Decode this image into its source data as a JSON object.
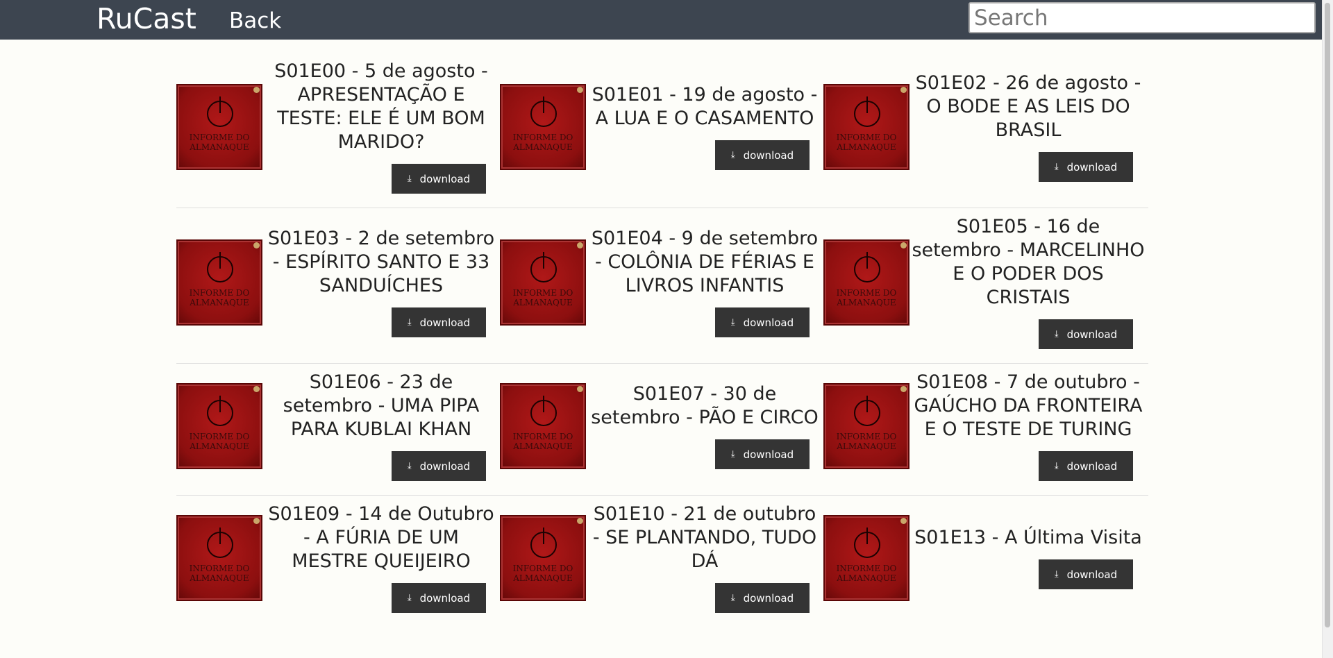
{
  "nav": {
    "brand": "RuCast",
    "back": "Back",
    "search_placeholder": "Search"
  },
  "cover": {
    "line1": "INFORME DO",
    "line2": "ALMANAQUE"
  },
  "download_label": "download",
  "rows": [
    [
      {
        "title": "S01E00 - 5 de agosto - APRESENTAÇÃO E TESTE: ELE É UM BOM MARIDO?"
      },
      {
        "title": "S01E01 - 19 de agosto - A LUA E O CASAMENTO"
      },
      {
        "title": "S01E02 - 26 de agosto - O BODE E AS LEIS DO BRASIL"
      }
    ],
    [
      {
        "title": "S01E03 - 2 de setembro - ESPÍRITO SANTO E 33 SANDUÍCHES"
      },
      {
        "title": "S01E04 - 9 de setembro - COLÔNIA DE FÉRIAS E LIVROS INFANTIS"
      },
      {
        "title": "S01E05 - 16 de setembro - MARCELINHO E O PODER DOS CRISTAIS"
      }
    ],
    [
      {
        "title": "S01E06 - 23 de setembro - UMA PIPA PARA KUBLAI KHAN"
      },
      {
        "title": "S01E07 - 30 de setembro - PÃO E CIRCO"
      },
      {
        "title": "S01E08 - 7 de outubro - GAÚCHO DA FRONTEIRA E O TESTE DE TURING"
      }
    ],
    [
      {
        "title": "S01E09 - 14 de Outubro - A FÚRIA DE UM MESTRE QUEIJEIRO"
      },
      {
        "title": "S01E10 - 21 de outubro - SE PLANTANDO, TUDO DÁ"
      },
      {
        "title": "S01E13 - A Última Visita"
      }
    ]
  ]
}
